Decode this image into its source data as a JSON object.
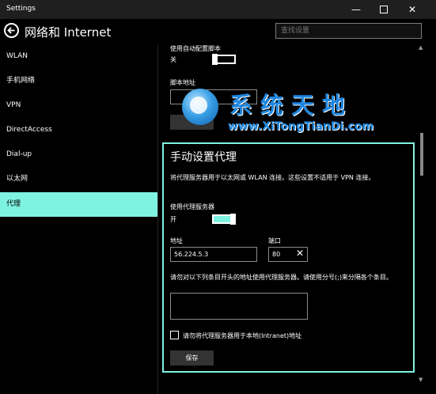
{
  "window": {
    "title": "Settings",
    "minimize_glyph": "—",
    "close_glyph": "✕"
  },
  "header": {
    "title": "网络和 Internet",
    "search_placeholder": "查找设置"
  },
  "sidebar": {
    "items": [
      {
        "label": "WLAN",
        "active": false
      },
      {
        "label": "手机网络",
        "active": false
      },
      {
        "label": "VPN",
        "active": false
      },
      {
        "label": "DirectAccess",
        "active": false
      },
      {
        "label": "Dial-up",
        "active": false
      },
      {
        "label": "以太网",
        "active": false
      },
      {
        "label": "代理",
        "active": true
      }
    ]
  },
  "auto_proxy": {
    "script_label": "使用自动配置脚本",
    "script_state": "关",
    "address_label": "脚本地址"
  },
  "manual_proxy": {
    "heading": "手动设置代理",
    "description": "将代理服务器用于以太网或 WLAN 连接。这些设置不适用于 VPN 连接。",
    "use_proxy_label": "使用代理服务器",
    "use_proxy_state": "开",
    "address_label": "地址",
    "address_value": "56.224.5.3",
    "port_label": "端口",
    "port_value": "80",
    "clear_glyph": "✕",
    "exceptions_label": "请勿对以下列条目开头的地址使用代理服务器。请使用分号(;)来分隔各个条目。",
    "exceptions_value": "",
    "local_checkbox_label": "请勿将代理服务器用于本地(Intranet)地址",
    "local_checkbox_checked": false,
    "save_label": "保存"
  },
  "watermark": {
    "cn_text": "系统天地",
    "en_text": "www.XiTongTianDi.com"
  },
  "colors": {
    "accent": "#7ff3e2",
    "watermark_blue": "#1e87e0",
    "background": "#000000"
  }
}
